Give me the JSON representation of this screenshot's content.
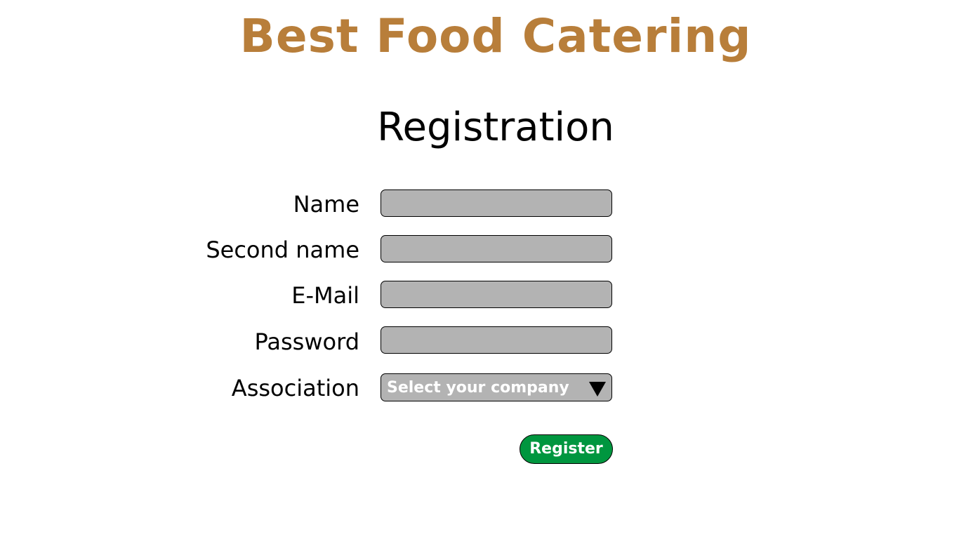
{
  "header": {
    "brand": "Best Food Catering"
  },
  "form": {
    "title": "Registration",
    "fields": [
      {
        "label": "Name",
        "value": "",
        "placeholder": ""
      },
      {
        "label": "Second name",
        "value": "",
        "placeholder": ""
      },
      {
        "label": "E-Mail",
        "value": "",
        "placeholder": ""
      },
      {
        "label": "Password",
        "value": "",
        "placeholder": ""
      }
    ],
    "association": {
      "label": "Association",
      "selected": "Select your company"
    },
    "submit_label": "Register"
  },
  "colors": {
    "brand": "#b87e3a",
    "field_bg": "#b3b3b3",
    "button_bg": "#00963f",
    "button_text": "#ffffff"
  },
  "icons": {
    "dropdown": "triangle-down-icon"
  }
}
